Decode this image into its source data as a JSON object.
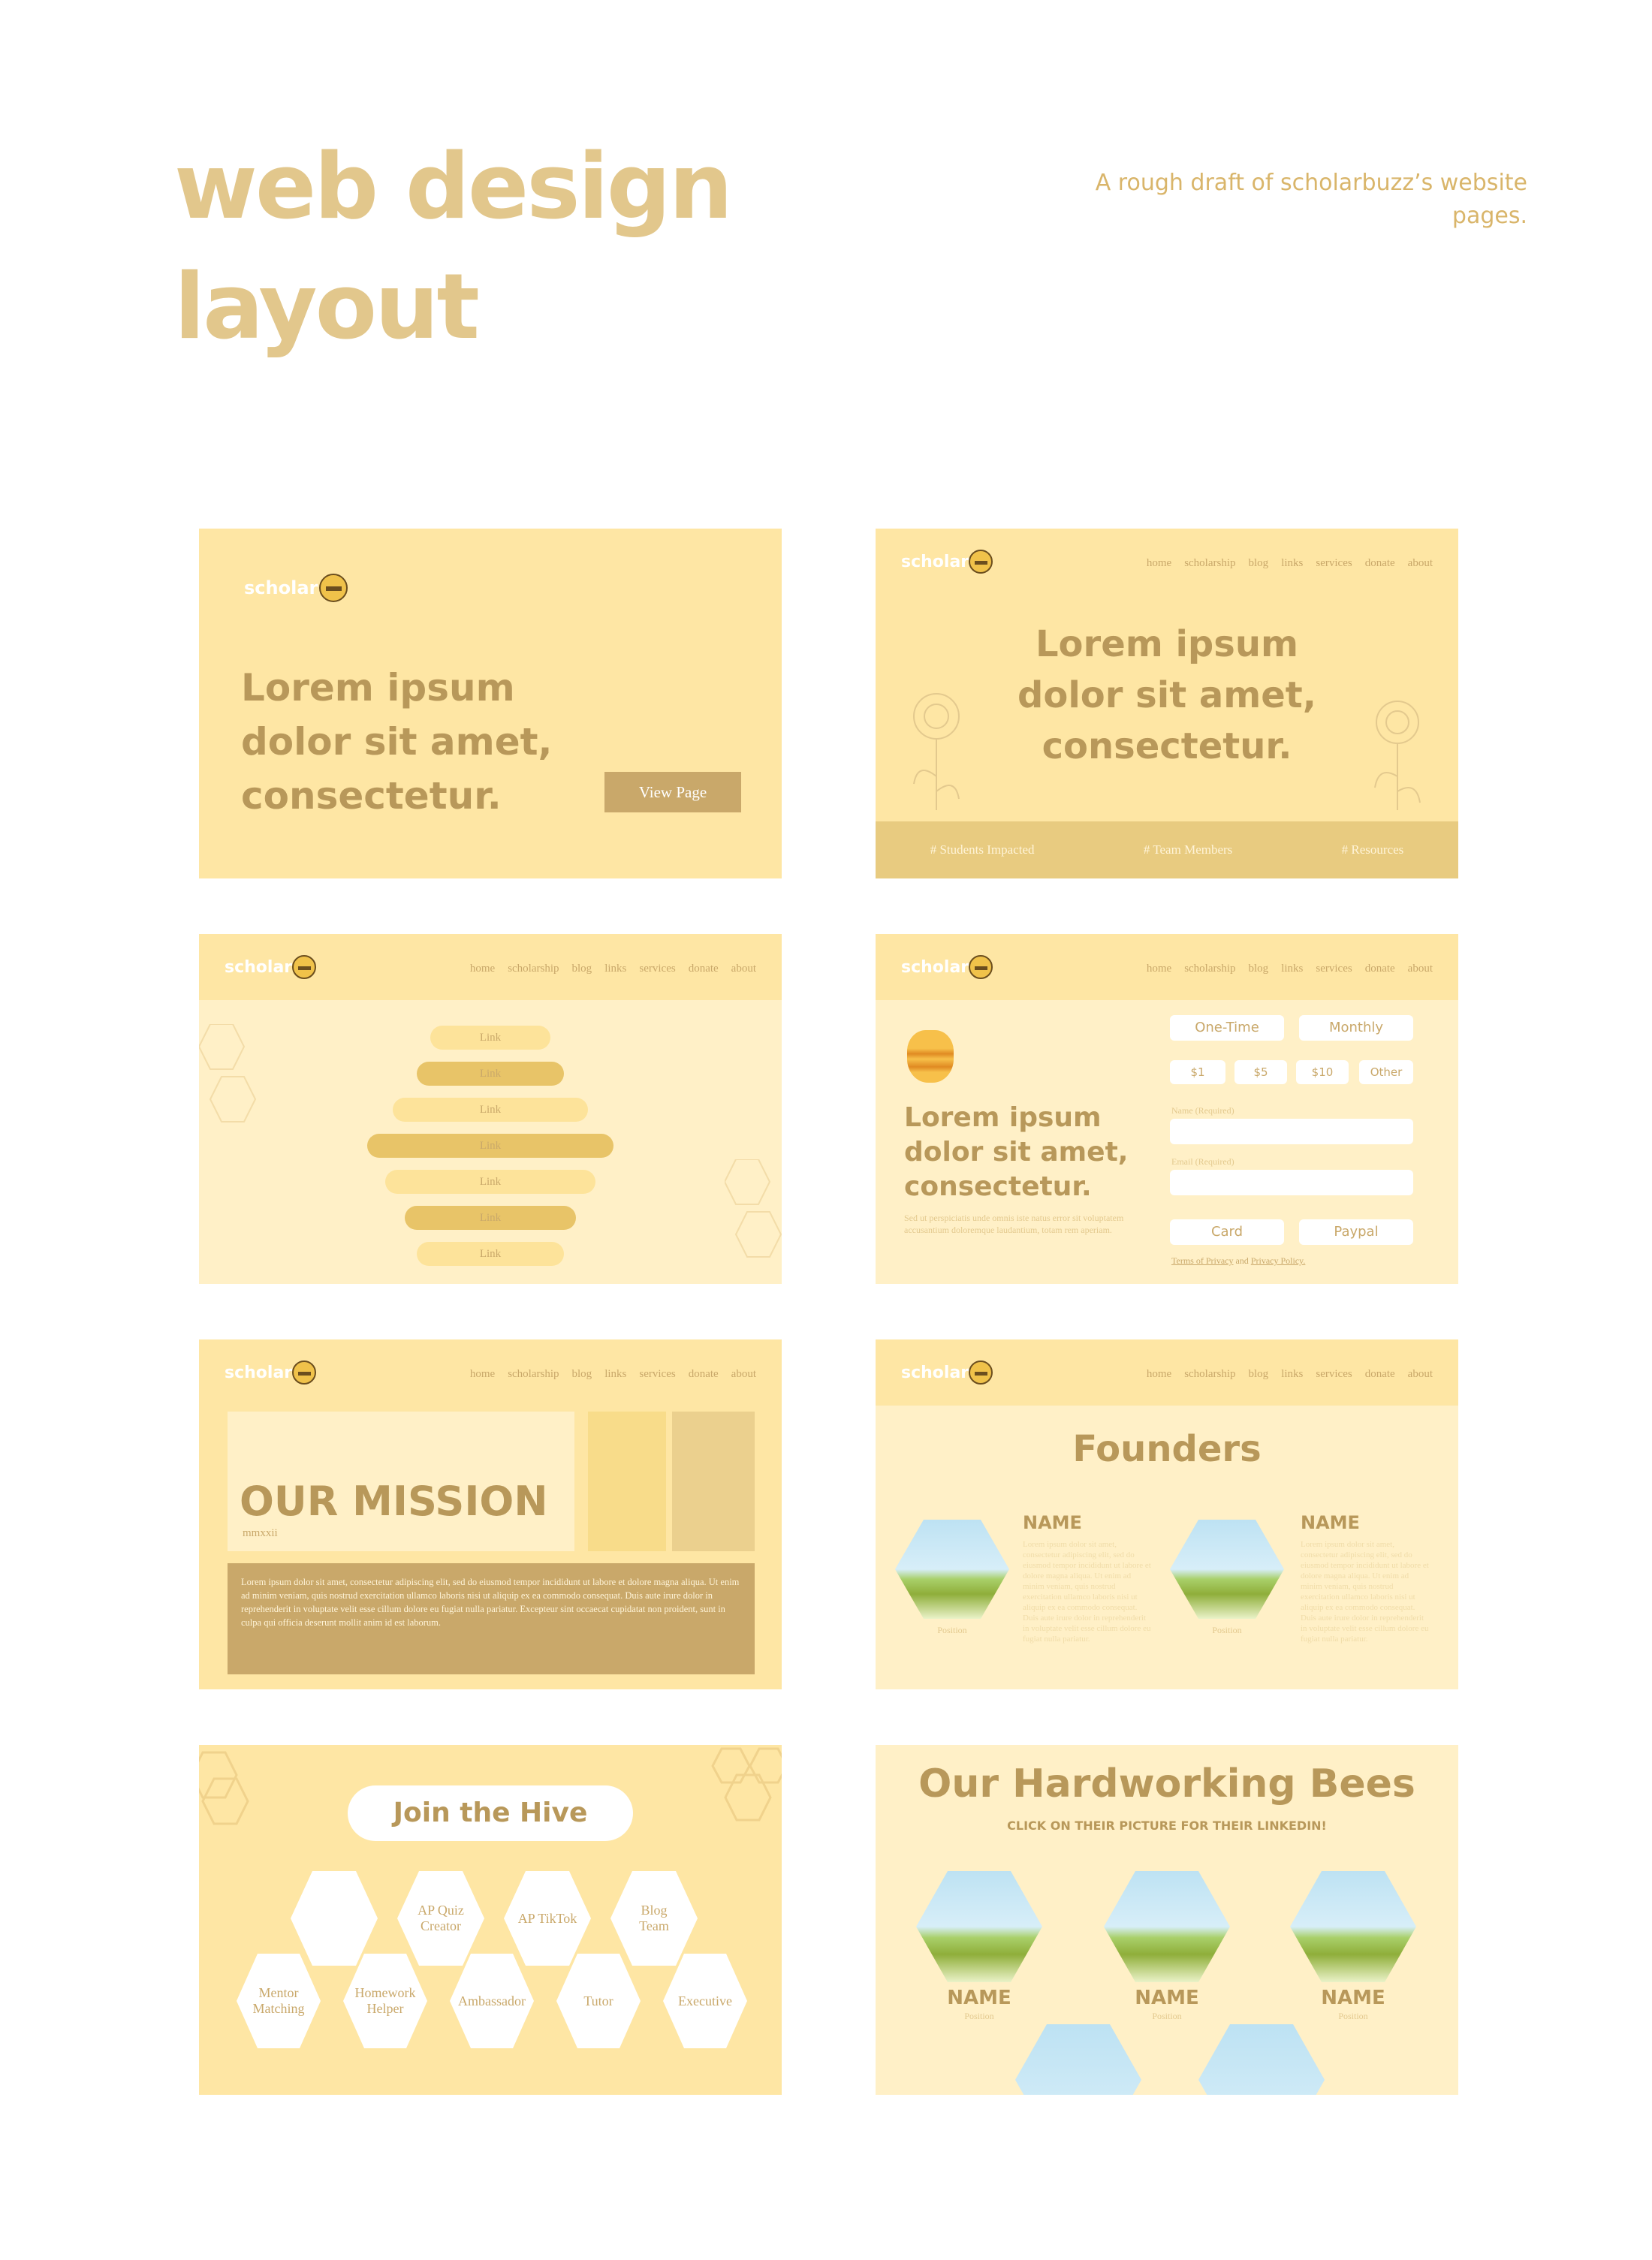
{
  "header": {
    "title_line1": "web design",
    "title_line2": "layout",
    "subtitle": "A rough draft of scholarbuzz’s website pages."
  },
  "brand": {
    "logo_text": "scholar",
    "accent": "#fee6a4",
    "dark": "#b8985a"
  },
  "nav": [
    "home",
    "scholarship",
    "blog",
    "links",
    "services",
    "donate",
    "about"
  ],
  "page1": {
    "headline_l1": "Lorem ipsum",
    "headline_l2": "dolor sit amet,",
    "headline_l3": "consectetur.",
    "button": "View Page"
  },
  "page2": {
    "headline_l1": "Lorem ipsum",
    "headline_l2": "dolor sit amet,",
    "headline_l3": "consectetur.",
    "stats": [
      "# Students Impacted",
      "# Team Members",
      "# Resources"
    ]
  },
  "page3": {
    "links": [
      "Link",
      "Link",
      "Link",
      "Link",
      "Link",
      "Link",
      "Link"
    ]
  },
  "page4": {
    "frequency": [
      "One-Time",
      "Monthly"
    ],
    "amounts": [
      "$1",
      "$5",
      "$10",
      "Other"
    ],
    "name_label": "Name (Required)",
    "email_label": "Email (Required)",
    "pay": [
      "Card",
      "Paypal"
    ],
    "headline_l1": "Lorem ipsum",
    "headline_l2": "dolor sit amet,",
    "headline_l3": "consectetur.",
    "body": "Sed ut perspiciatis unde omnis iste natus error sit voluptatem accusantium doloremque laudantium, totam rem aperiam.",
    "terms": "Terms of Privacy",
    "and": "and",
    "policy": "Privacy Policy."
  },
  "page5": {
    "mission": "OUR MISSION",
    "sub": "mmxxii",
    "body": "Lorem ipsum dolor sit amet, consectetur adipiscing elit, sed do eiusmod tempor incididunt ut labore et dolore magna aliqua. Ut enim ad minim veniam, quis nostrud exercitation ullamco laboris nisi ut aliquip ex ea commodo consequat. Duis aute irure dolor in reprehenderit in voluptate velit esse cillum dolore eu fugiat nulla pariatur. Excepteur sint occaecat cupidatat non proident, sunt in culpa qui officia deserunt mollit anim id est laborum."
  },
  "page6": {
    "title": "Founders",
    "founders": [
      {
        "name": "NAME",
        "position": "Position"
      },
      {
        "name": "NAME",
        "position": "Position"
      }
    ],
    "bio": "Lorem ipsum dolor sit amet, consectetur adipiscing elit, sed do eiusmod tempor incididunt ut labore et dolore magna aliqua. Ut enim ad minim veniam, quis nostrud exercitation ullamco laboris nisi ut aliquip ex ea commodo consequat. Duis aute irure dolor in reprehenderit in voluptate velit esse cillum dolore eu fugiat nulla pariatur."
  },
  "page7": {
    "title": "Join the Hive",
    "hexes_top": [
      "",
      "AP Quiz Creator",
      "AP TikTok",
      "Blog Team"
    ],
    "hexes_bottom": [
      "Mentor Matching",
      "Homework Helper",
      "Ambassador",
      "Tutor",
      "Executive"
    ]
  },
  "page8": {
    "title": "Our Hardworking Bees",
    "subtitle": "CLICK ON THEIR PICTURE FOR THEIR LINKEDIN!",
    "members": [
      {
        "name": "NAME",
        "position": "Position"
      },
      {
        "name": "NAME",
        "position": "Position"
      },
      {
        "name": "NAME",
        "position": "Position"
      }
    ]
  }
}
